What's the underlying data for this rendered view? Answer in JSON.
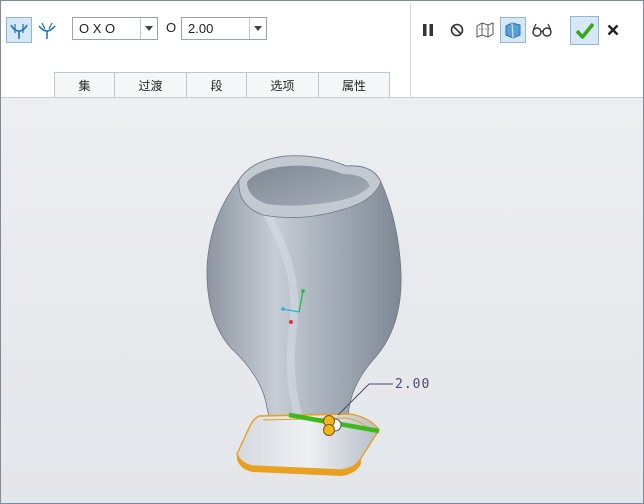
{
  "toolbar": {
    "mode_combo": {
      "value": "O X O"
    },
    "radius_label": "O",
    "radius_combo": {
      "value": "2.00"
    }
  },
  "tabs": [
    {
      "label": "集"
    },
    {
      "label": "过渡"
    },
    {
      "label": "段"
    },
    {
      "label": "选项"
    },
    {
      "label": "属性"
    }
  ],
  "viewport": {
    "dimension_label": "2.00"
  },
  "colors": {
    "accent_green": "#58b31a",
    "selection_orange": "#e8a020",
    "model_gray": "#aab3bf"
  }
}
